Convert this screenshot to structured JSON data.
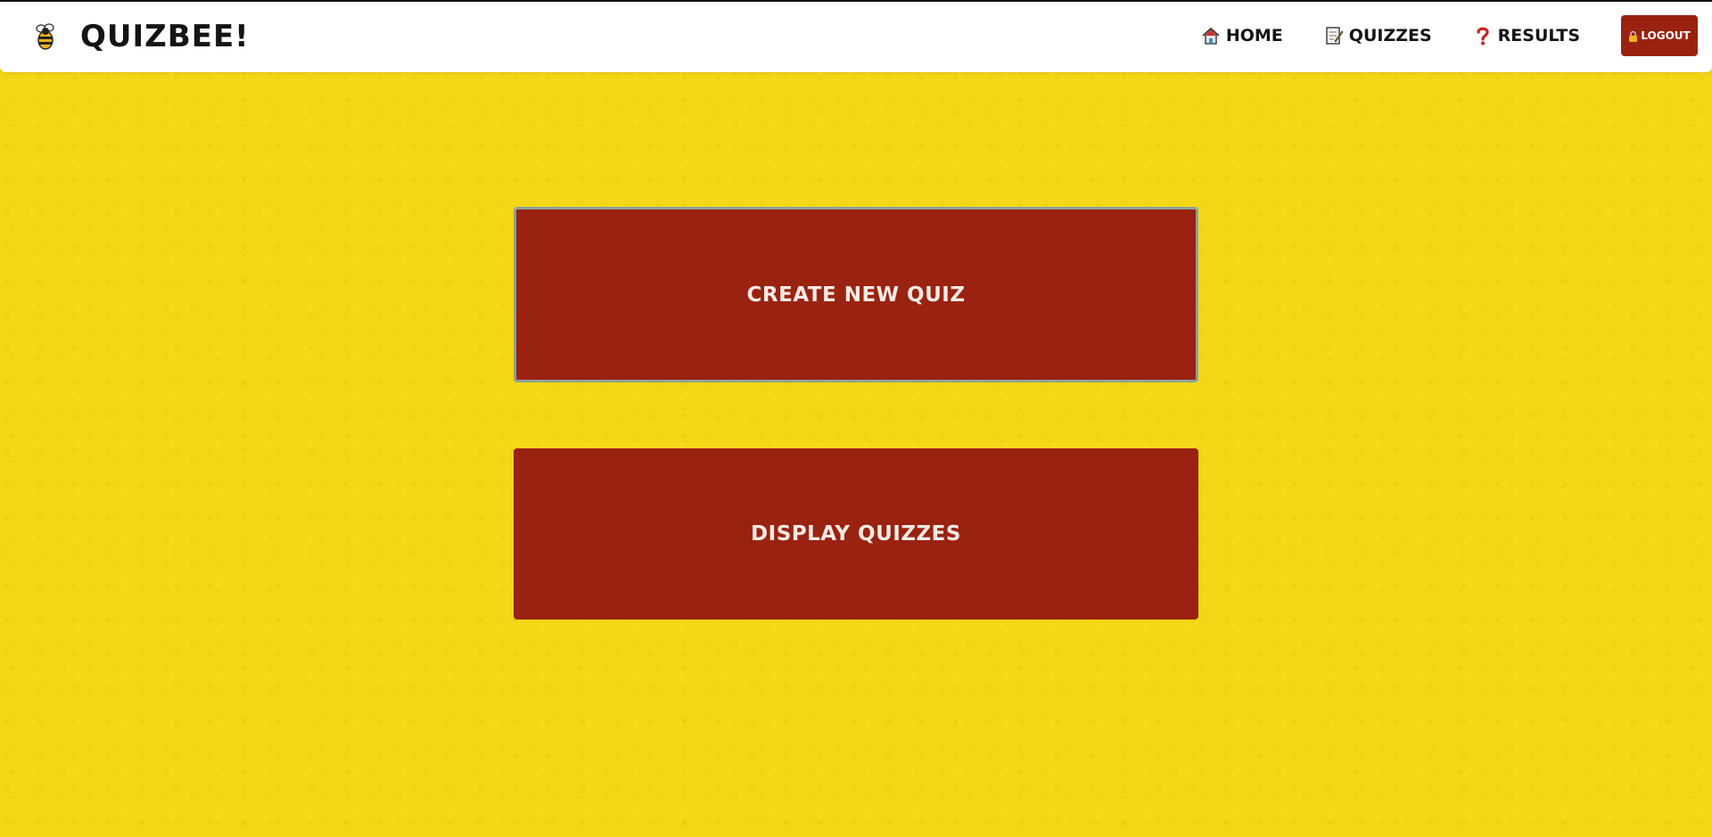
{
  "brand": {
    "name": "QUIZBEE!",
    "icon": "bee-icon"
  },
  "nav": {
    "items": [
      {
        "label": "HOME",
        "icon": "home-icon"
      },
      {
        "label": "QUIZZES",
        "icon": "memo-icon"
      },
      {
        "label": "RESULTS",
        "icon": "question-mark-icon"
      }
    ],
    "logout_label": "LOGOUT",
    "logout_icon": "lock-icon"
  },
  "main": {
    "create_label": "CREATE NEW QUIZ",
    "display_label": "DISPLAY QUIZZES"
  },
  "colors": {
    "background": "#f4d716",
    "button": "#9a2210",
    "header": "#ffffff"
  }
}
